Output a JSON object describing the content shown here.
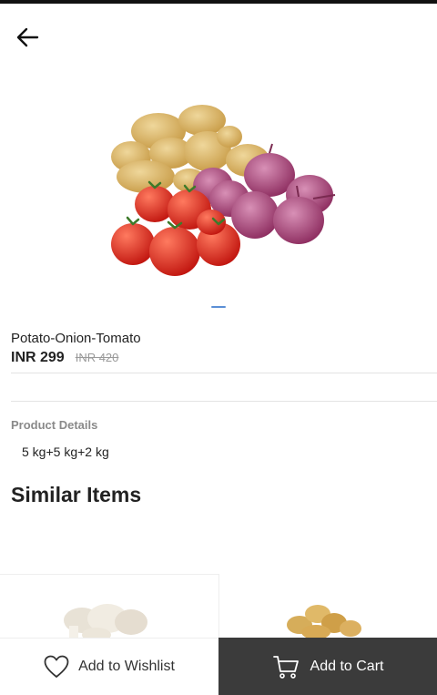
{
  "colors": {
    "accent": "#5b8fd6",
    "cart_button_bg": "#3b3b3b",
    "mrp_text": "#9a9a9a",
    "section_label": "#8a8a8a"
  },
  "header": {
    "back_icon": "arrow-left-icon"
  },
  "product": {
    "name": "Potato-Onion-Tomato",
    "price": "INR 299",
    "mrp": "INR 420",
    "image_alt": "potatoes, onions and tomatoes",
    "image_count": 1,
    "current_image": 1
  },
  "details": {
    "title": "Product Details",
    "value": "5 kg+5 kg+2 kg"
  },
  "similar": {
    "title": "Similar Items",
    "items": [
      {
        "image": "mushrooms"
      },
      {
        "image": "potatoes"
      }
    ]
  },
  "actions": {
    "wishlist_label": "Add to Wishlist",
    "wishlist_icon": "heart-icon",
    "cart_label": "Add to Cart",
    "cart_icon": "cart-icon"
  }
}
